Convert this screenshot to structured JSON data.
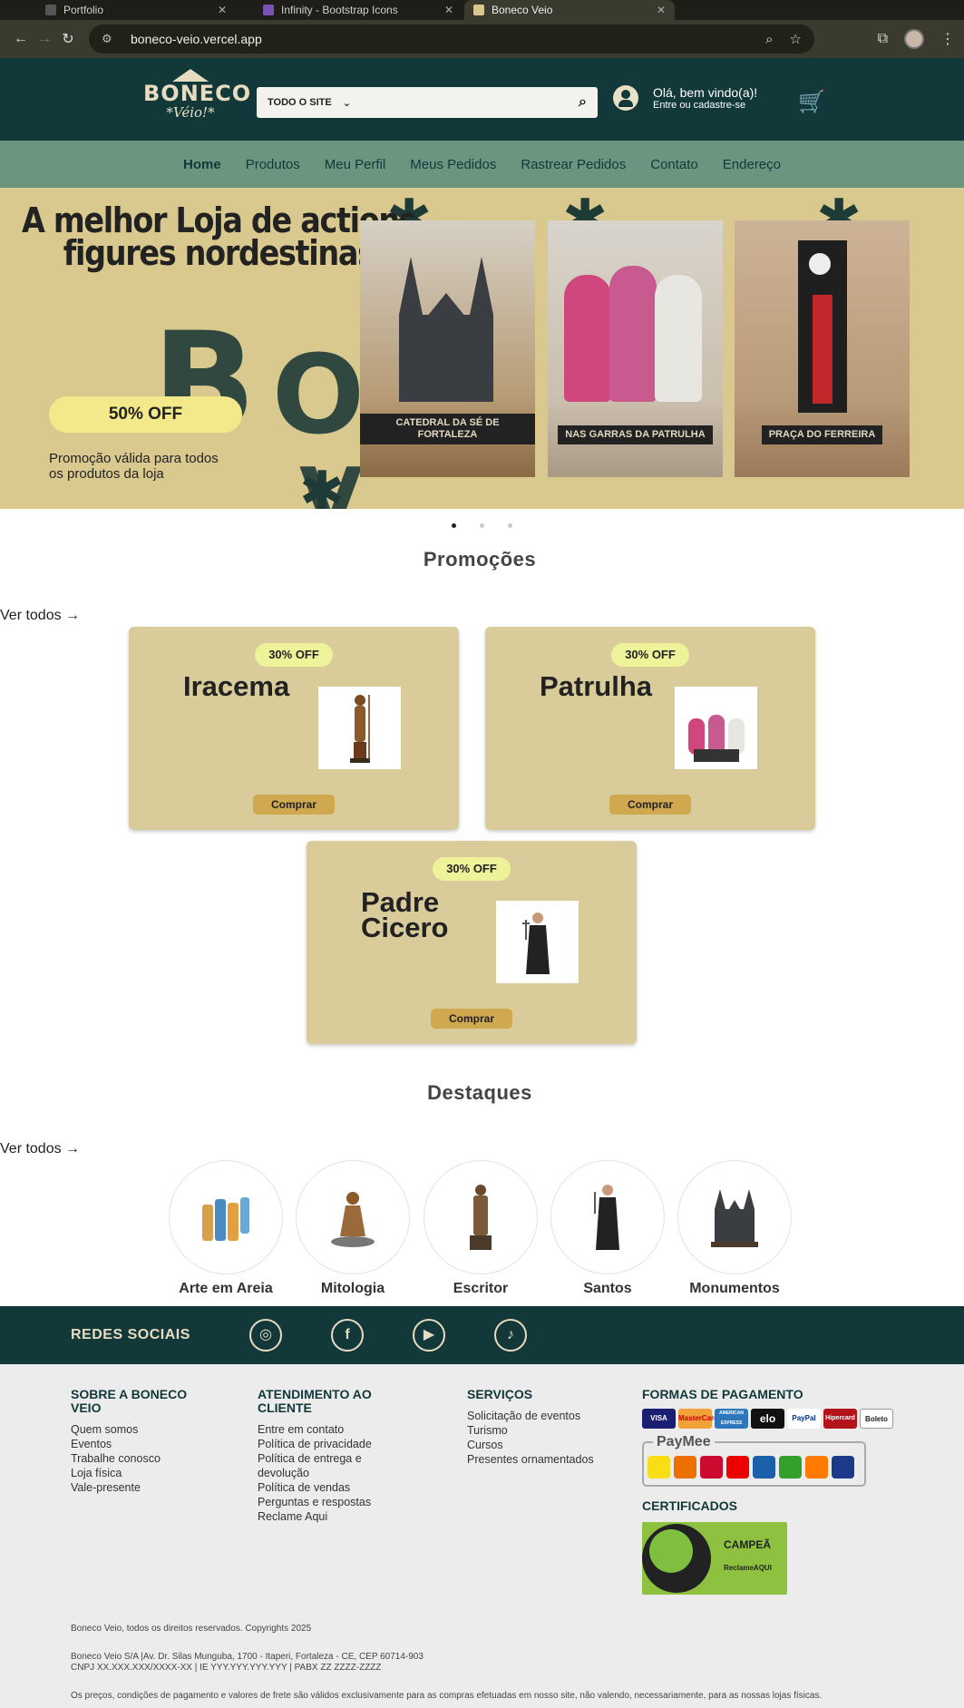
{
  "browser": {
    "tabs": [
      {
        "label": "Portfolio"
      },
      {
        "label": "Infinity - Bootstrap Icons"
      },
      {
        "label": "Boneco Veio"
      }
    ],
    "url": "boneco-veio.vercel.app"
  },
  "header": {
    "logo_line1": "BONECO",
    "logo_line2": "*Véio!*",
    "search_scope": "TODO O SITE",
    "search_placeholder": "",
    "greeting": "Olá, bem vindo(a)!",
    "login_link": "Entre ou cadastre-se"
  },
  "nav": {
    "items": [
      "Home",
      "Produtos",
      "Meu Perfil",
      "Meus Pedidos",
      "Rastrear Pedidos",
      "Contato",
      "Endereço"
    ]
  },
  "hero": {
    "headline_1": "A melhor Loja de actions",
    "headline_2": "figures nordestinas",
    "promo": "50% OFF",
    "note": "Promoção válida para todos os produtos da loja",
    "photo_captions": [
      "CATEDRAL DA SÉ DE FORTALEZA",
      "NAS GARRAS DA PATRULHA",
      "PRAÇA DO FERREIRA"
    ],
    "slides": 3,
    "active_slide": 1
  },
  "promotions": {
    "title": "Promoções",
    "see_all": "Ver todos →",
    "cards": [
      {
        "badge": "30% OFF",
        "name": "Iracema",
        "button": "Comprar"
      },
      {
        "badge": "30% OFF",
        "name": "Patrulha",
        "button": "Comprar"
      },
      {
        "badge": "30% OFF",
        "name": "Padre Cicero",
        "button": "Comprar"
      }
    ]
  },
  "featured": {
    "title": "Destaques",
    "see_all": "Ver todos →",
    "categories": [
      "Arte em Areia",
      "Mitologia",
      "Escritor",
      "Santos",
      "Monumentos"
    ]
  },
  "social": {
    "label": "REDES SOCIAIS",
    "icons": [
      "instagram-icon",
      "facebook-icon",
      "youtube-icon",
      "tiktok-icon"
    ]
  },
  "footer": {
    "about": {
      "title": "SOBRE A BONECO VEIO",
      "links": [
        "Quem somos",
        "Eventos",
        "Trabalhe conosco",
        "Loja física",
        "Vale-presente"
      ]
    },
    "support": {
      "title": "ATENDIMENTO AO CLIENTE",
      "links": [
        "Entre em contato",
        "Política de privacidade",
        "Política de entrega e devolução",
        "Política de vendas",
        "Perguntas e respostas",
        "Reclame Aqui"
      ]
    },
    "services": {
      "title": "SERVIÇOS",
      "links": [
        "Solicitação de eventos",
        "Turismo",
        "Cursos",
        "Presentes ornamentados"
      ]
    },
    "payment": {
      "title": "FORMAS DE PAGAMENTO",
      "methods": [
        "VISA",
        "MasterCard",
        "AMERICAN EXPRESS",
        "elo",
        "PayPal",
        "Hipercard",
        "Boleto"
      ],
      "paymee": "PayMee",
      "banks": [
        "bb",
        "itaú",
        "bradesco",
        "santander",
        "caixa",
        "sicredi",
        "inter",
        "bs2"
      ]
    },
    "certificates": {
      "title": "CERTIFICADOS",
      "badge_text": "CAMPEÃ",
      "badge_sub": "ReclameAQUI"
    },
    "copyright": "Boneco Veio, todos os direitos reservados. Copyrights 2025",
    "address": "Boneco Veio S/A |Av. Dr. Silas Munguba, 1700 - Itaperi, Fortaleza - CE, CEP 60714-903",
    "cnpj": "CNPJ XX.XXX.XXX/XXXX-XX | IE YYY.YYY.YYY.YYY | PABX ZZ ZZZZ-ZZZZ",
    "disclaimer": "Os preços, condições de pagamento e valores de frete são válidos exclusivamente para as compras efetuadas em nosso site, não valendo, necessariamente, para as nossas lojas físicas."
  },
  "colors": {
    "primary_dark": "#12383a",
    "nav_green": "#6c9580",
    "sand": "#d9cc9a",
    "promo_yellow": "#f4e98a",
    "button_gold": "#cfa850"
  }
}
